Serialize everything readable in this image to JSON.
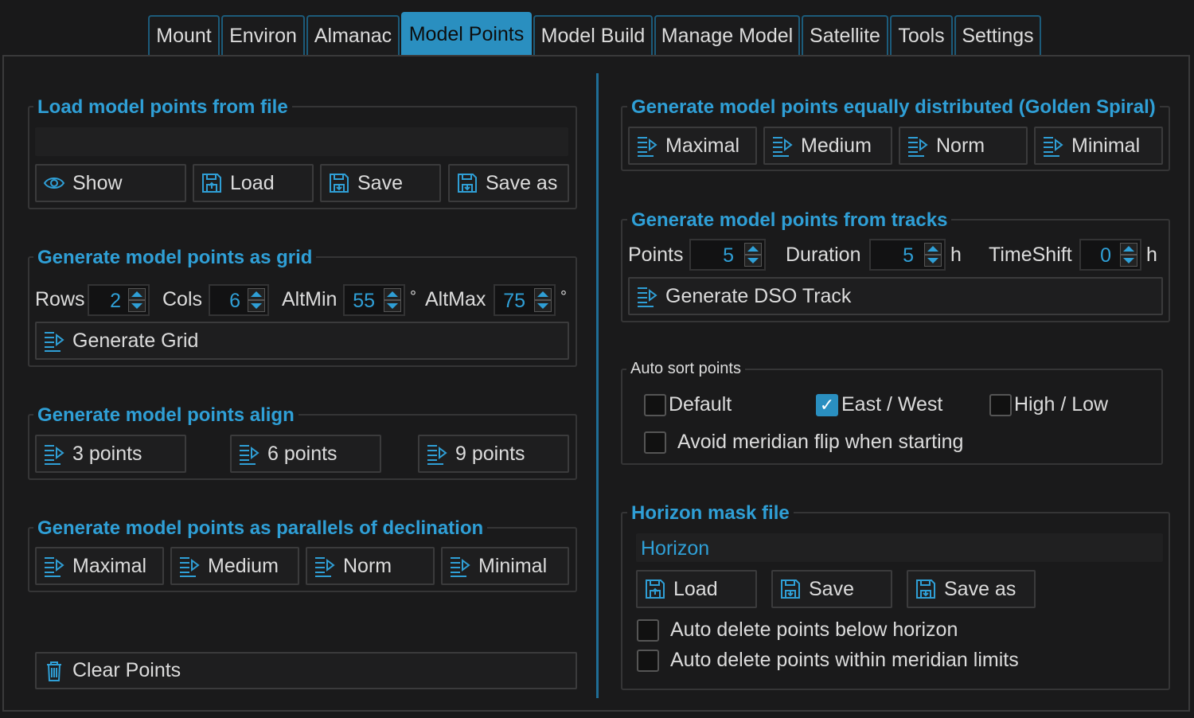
{
  "tabs": [
    {
      "label": "Mount"
    },
    {
      "label": "Environ"
    },
    {
      "label": "Almanac"
    },
    {
      "label": "Model Points",
      "active": true
    },
    {
      "label": "Model Build"
    },
    {
      "label": "Manage Model"
    },
    {
      "label": "Satellite"
    },
    {
      "label": "Tools"
    },
    {
      "label": "Settings"
    }
  ],
  "colors": {
    "accent": "#2f9fd6",
    "tab_active": "#2a8fc0",
    "background": "#19191a",
    "text": "#dcdcdc"
  },
  "load_file": {
    "title": "Load model points from file",
    "filename": "",
    "buttons": [
      {
        "label": "Show",
        "icon": "eye-icon"
      },
      {
        "label": "Load",
        "icon": "load-icon"
      },
      {
        "label": "Save",
        "icon": "save-icon"
      },
      {
        "label": "Save as",
        "icon": "save-as-icon"
      }
    ]
  },
  "grid": {
    "title": "Generate model points as grid",
    "rows_label": "Rows",
    "rows": "2",
    "cols_label": "Cols",
    "cols": "6",
    "altmin_label": "AltMin",
    "altmin": "55",
    "altmax_label": "AltMax",
    "altmax": "75",
    "degree": "°",
    "button": "Generate Grid"
  },
  "align": {
    "title": "Generate model points align",
    "buttons": [
      "3 points",
      "6 points",
      "9 points"
    ]
  },
  "parallels": {
    "title": "Generate model points as parallels of declination",
    "buttons": [
      "Maximal",
      "Medium",
      "Norm",
      "Minimal"
    ]
  },
  "clear_points": "Clear Points",
  "golden_spiral": {
    "title": "Generate model points equally distributed (Golden Spiral)",
    "buttons": [
      "Maximal",
      "Medium",
      "Norm",
      "Minimal"
    ]
  },
  "tracks": {
    "title": "Generate model points from tracks",
    "points_label": "Points",
    "points": "5",
    "duration_label": "Duration",
    "duration": "5",
    "timeshift_label": "TimeShift",
    "timeshift": "0",
    "unit_h": "h",
    "button": "Generate DSO Track"
  },
  "auto_sort": {
    "title": "Auto sort points",
    "default": {
      "label": "Default",
      "checked": false
    },
    "east_west": {
      "label": "East / West",
      "checked": true
    },
    "high_low": {
      "label": "High / Low",
      "checked": false
    },
    "avoid_flip": {
      "label": "Avoid meridian flip when starting",
      "checked": false
    }
  },
  "horizon": {
    "title": "Horizon mask file",
    "filename": "Horizon",
    "buttons": [
      {
        "label": "Load",
        "icon": "load-icon"
      },
      {
        "label": "Save",
        "icon": "save-icon"
      },
      {
        "label": "Save as",
        "icon": "save-as-icon"
      }
    ],
    "auto_delete_below": {
      "label": "Auto delete points below horizon",
      "checked": false
    },
    "auto_delete_meridian": {
      "label": "Auto delete points within meridian limits",
      "checked": false
    }
  }
}
